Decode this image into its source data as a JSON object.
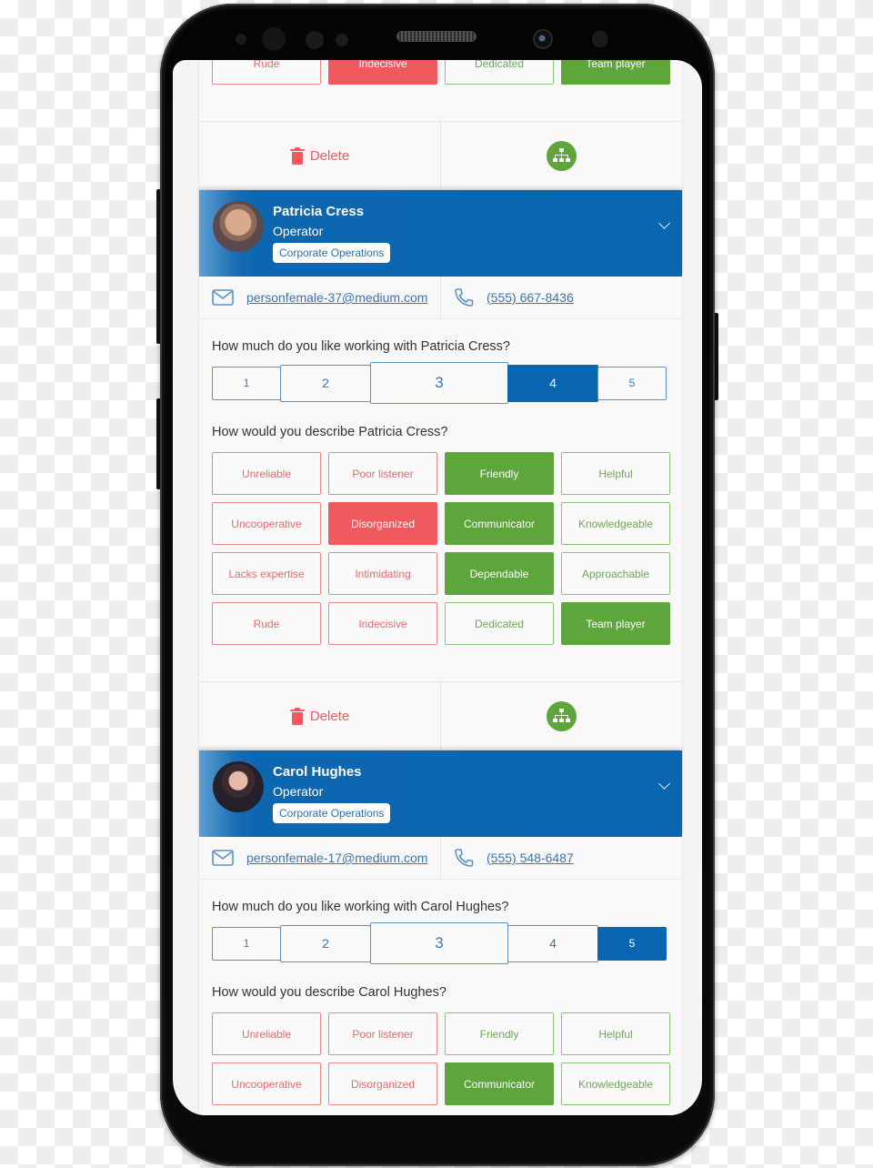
{
  "colors": {
    "primary_blue": "#0a66b0",
    "negative_red": "#ef5a5e",
    "positive_green": "#5ea53c",
    "link_blue": "#3d74b3"
  },
  "previous_card": {
    "last_row_tags": [
      {
        "label": "Rude",
        "type": "negative",
        "selected": false
      },
      {
        "label": "Indecisive",
        "type": "negative",
        "selected": true
      },
      {
        "label": "Dedicated",
        "type": "positive",
        "selected": false
      },
      {
        "label": "Team player",
        "type": "positive",
        "selected": true
      }
    ],
    "actions": {
      "delete_label": "Delete",
      "org_chart_icon": "sitemap-icon",
      "trash_icon": "trash-icon"
    }
  },
  "people": [
    {
      "name": "Patricia Cress",
      "role": "Operator",
      "department": "Corporate Operations",
      "email": "personfemale-37@medium.com",
      "phone": "(555) 667-8436",
      "email_icon": "envelope-icon",
      "phone_icon": "phone-icon",
      "rating_question": "How much do you like working with Patricia Cress?",
      "rating_options": [
        "1",
        "2",
        "3",
        "4",
        "5"
      ],
      "rating_selected": 4,
      "describe_question": "How would you describe Patricia Cress?",
      "tags": [
        {
          "label": "Unreliable",
          "type": "negative",
          "selected": false
        },
        {
          "label": "Poor listener",
          "type": "negative",
          "selected": false
        },
        {
          "label": "Friendly",
          "type": "positive",
          "selected": true
        },
        {
          "label": "Helpful",
          "type": "positive",
          "selected": false
        },
        {
          "label": "Uncooperative",
          "type": "negative",
          "selected": false
        },
        {
          "label": "Disorganized",
          "type": "negative",
          "selected": true
        },
        {
          "label": "Communicator",
          "type": "positive",
          "selected": true
        },
        {
          "label": "Knowledgeable",
          "type": "positive",
          "selected": false
        },
        {
          "label": "Lacks expertise",
          "type": "negative",
          "selected": false
        },
        {
          "label": "Intimidating",
          "type": "negative",
          "selected": false
        },
        {
          "label": "Dependable",
          "type": "positive",
          "selected": true
        },
        {
          "label": "Approachable",
          "type": "positive",
          "selected": false
        },
        {
          "label": "Rude",
          "type": "negative",
          "selected": false
        },
        {
          "label": "Indecisive",
          "type": "negative",
          "selected": false
        },
        {
          "label": "Dedicated",
          "type": "positive",
          "selected": false
        },
        {
          "label": "Team player",
          "type": "positive",
          "selected": true
        }
      ],
      "actions": {
        "delete_label": "Delete"
      }
    },
    {
      "name": "Carol Hughes",
      "role": "Operator",
      "department": "Corporate Operations",
      "email": "personfemale-17@medium.com",
      "phone": "(555) 548-6487",
      "rating_question": "How much do you like working with Carol Hughes?",
      "rating_options": [
        "1",
        "2",
        "3",
        "4",
        "5"
      ],
      "rating_selected": 5,
      "describe_question": "How would you describe Carol Hughes?",
      "tags": [
        {
          "label": "Unreliable",
          "type": "negative",
          "selected": false
        },
        {
          "label": "Poor listener",
          "type": "negative",
          "selected": false
        },
        {
          "label": "Friendly",
          "type": "positive",
          "selected": false
        },
        {
          "label": "Helpful",
          "type": "positive",
          "selected": false
        },
        {
          "label": "Uncooperative",
          "type": "negative",
          "selected": false
        },
        {
          "label": "Disorganized",
          "type": "negative",
          "selected": false
        },
        {
          "label": "Communicator",
          "type": "positive",
          "selected": true
        },
        {
          "label": "Knowledgeable",
          "type": "positive",
          "selected": false
        }
      ]
    }
  ]
}
